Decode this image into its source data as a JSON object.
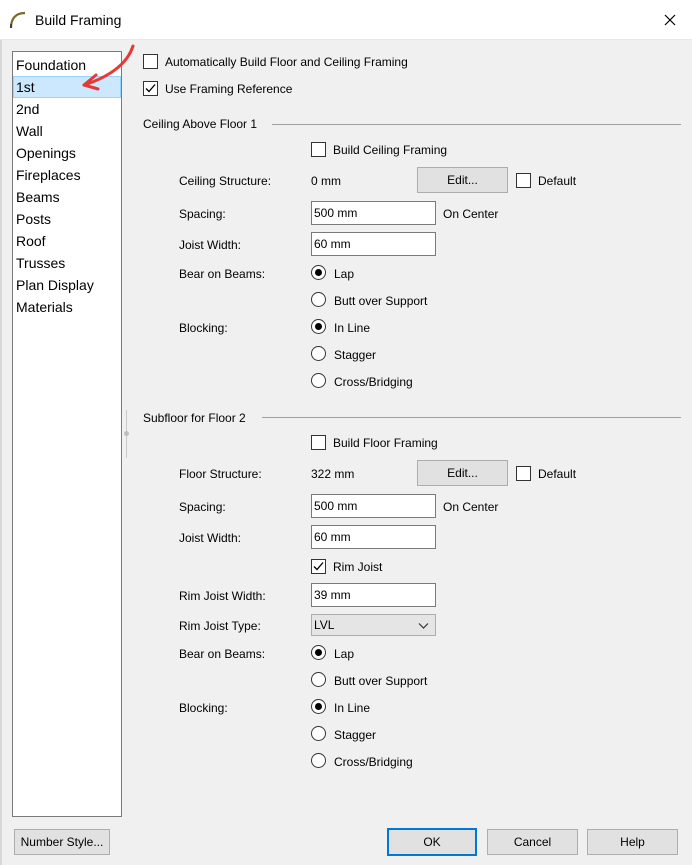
{
  "window": {
    "title": "Build Framing"
  },
  "categories": [
    {
      "label": "Foundation",
      "selected": false
    },
    {
      "label": "1st",
      "selected": true
    },
    {
      "label": "2nd",
      "selected": false
    },
    {
      "label": "Wall",
      "selected": false
    },
    {
      "label": "Openings",
      "selected": false
    },
    {
      "label": "Fireplaces",
      "selected": false
    },
    {
      "label": "Beams",
      "selected": false
    },
    {
      "label": "Posts",
      "selected": false
    },
    {
      "label": "Roof",
      "selected": false
    },
    {
      "label": "Trusses",
      "selected": false
    },
    {
      "label": "Plan Display",
      "selected": false
    },
    {
      "label": "Materials",
      "selected": false
    }
  ],
  "top_options": {
    "auto_build_label": "Automatically Build Floor and Ceiling Framing",
    "auto_build_checked": false,
    "use_ref_label": "Use Framing Reference",
    "use_ref_checked": true
  },
  "ceiling": {
    "header": "Ceiling Above Floor 1",
    "build_label": "Build Ceiling Framing",
    "build_checked": false,
    "structure_label": "Ceiling Structure:",
    "structure_value": "0 mm",
    "edit_label": "Edit...",
    "default_label": "Default",
    "default_checked": false,
    "spacing_label": "Spacing:",
    "spacing_value": "500 mm",
    "on_center": "On Center",
    "joist_width_label": "Joist Width:",
    "joist_width_value": "60 mm",
    "bear_label": "Bear on Beams:",
    "lap": "Lap",
    "butt": "Butt over Support",
    "bear_selected": "Lap",
    "blocking_label": "Blocking:",
    "inline": "In Line",
    "stagger": "Stagger",
    "cross": "Cross/Bridging",
    "blocking_selected": "In Line"
  },
  "subfloor": {
    "header": "Subfloor for Floor 2",
    "build_label": "Build Floor Framing",
    "build_checked": false,
    "structure_label": "Floor Structure:",
    "structure_value": "322 mm",
    "edit_label": "Edit...",
    "default_label": "Default",
    "default_checked": false,
    "spacing_label": "Spacing:",
    "spacing_value": "500 mm",
    "on_center": "On Center",
    "joist_width_label": "Joist Width:",
    "joist_width_value": "60 mm",
    "rim_joist_label": "Rim Joist",
    "rim_joist_checked": true,
    "rim_width_label": "Rim Joist Width:",
    "rim_width_value": "39 mm",
    "rim_type_label": "Rim Joist Type:",
    "rim_type_value": "LVL",
    "bear_label": "Bear on Beams:",
    "lap": "Lap",
    "butt": "Butt over Support",
    "bear_selected": "Lap",
    "blocking_label": "Blocking:",
    "inline": "In Line",
    "stagger": "Stagger",
    "cross": "Cross/Bridging",
    "blocking_selected": "In Line"
  },
  "footer": {
    "number_style": "Number Style...",
    "ok": "OK",
    "cancel": "Cancel",
    "help": "Help"
  },
  "colors": {
    "selection": "#cce8ff",
    "default_button_border": "#0078d7",
    "annotation_arrow": "#e53935"
  }
}
